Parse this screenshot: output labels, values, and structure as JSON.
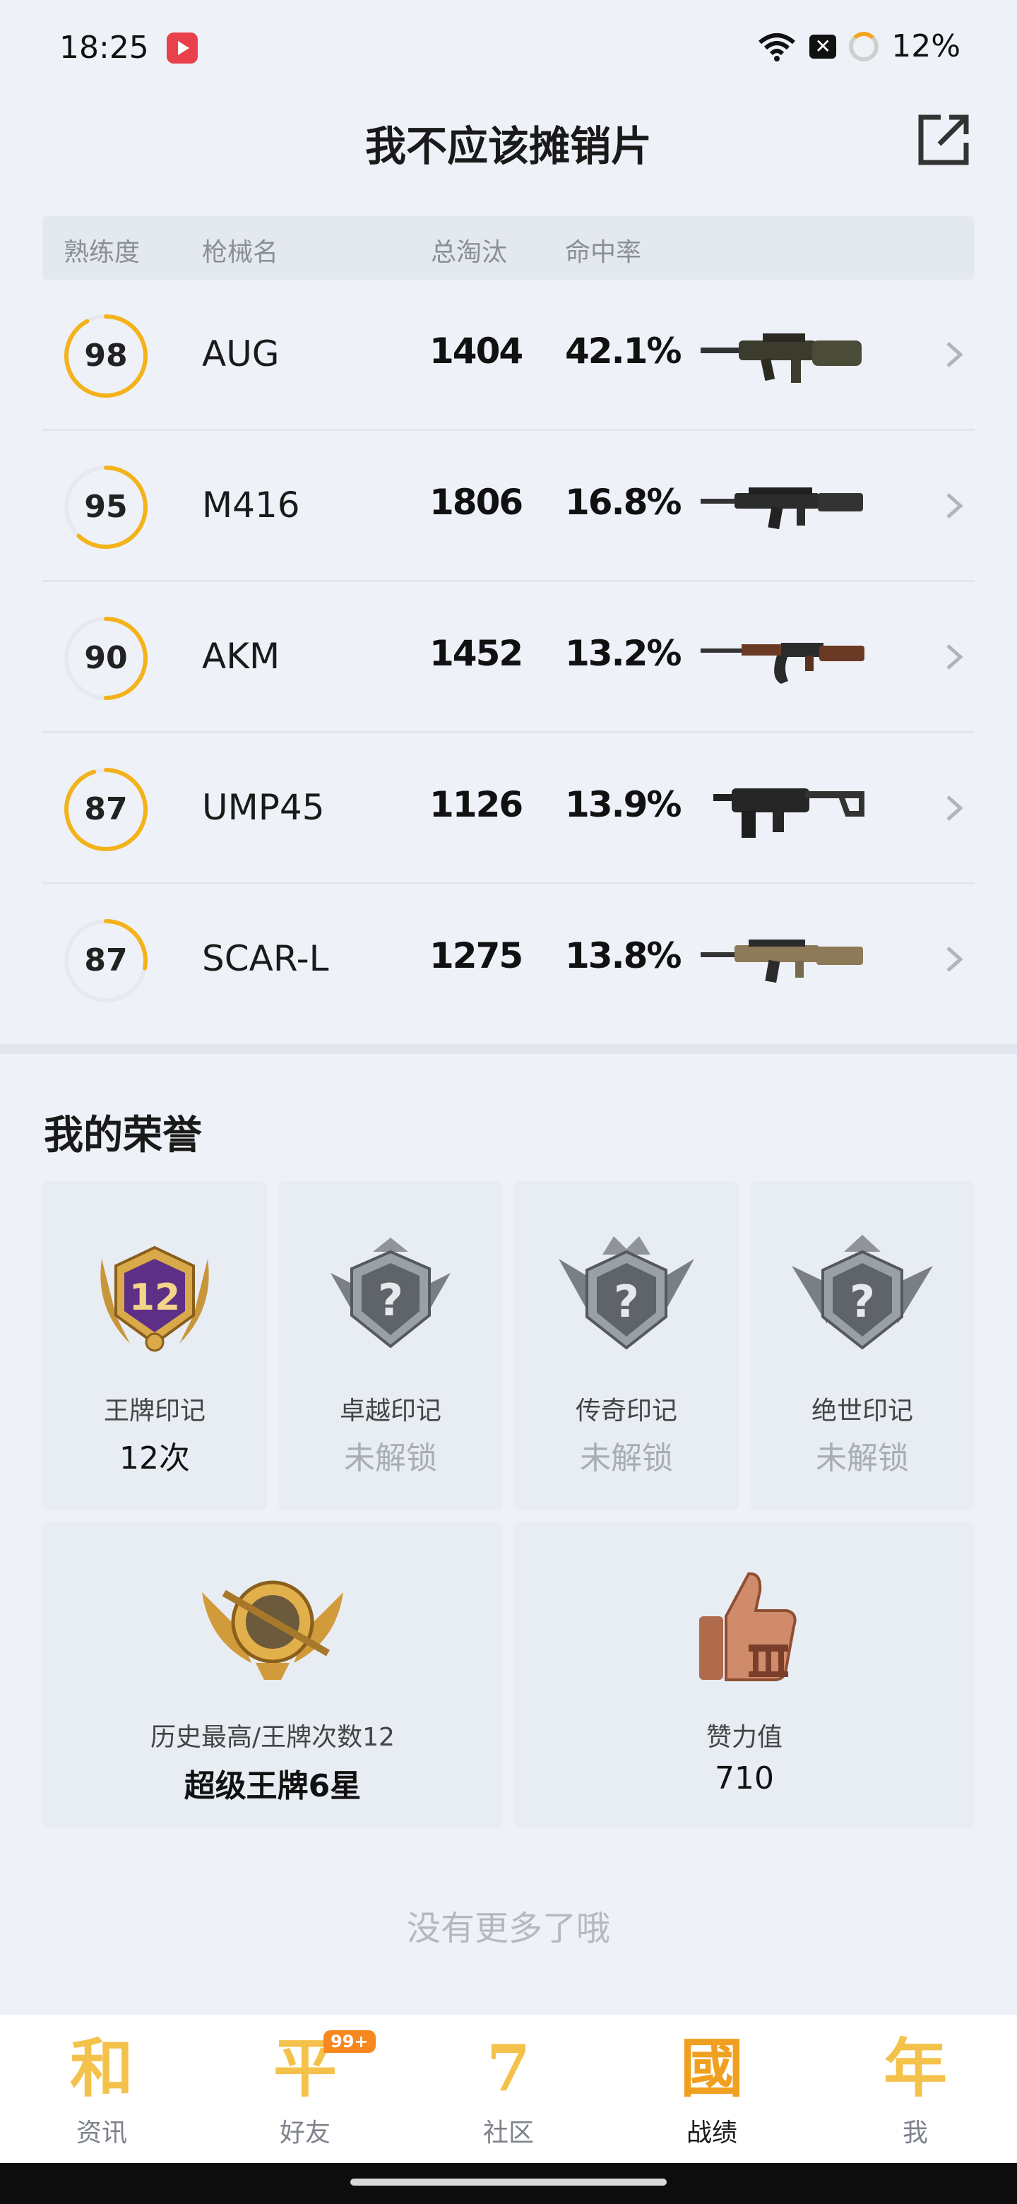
{
  "status_bar": {
    "time": "18:25",
    "battery": "12%"
  },
  "header": {
    "title": "我不应该摊销片"
  },
  "table": {
    "headers": [
      "熟练度",
      "枪械名",
      "总淘汰",
      "命中率"
    ],
    "rows": [
      {
        "mastery": "98",
        "name": "AUG",
        "kills": "1404",
        "accuracy": "42.1%",
        "gun_icon": "aug-rifle-icon",
        "progress": 0.92
      },
      {
        "mastery": "95",
        "name": "M416",
        "kills": "1806",
        "accuracy": "16.8%",
        "gun_icon": "m416-rifle-icon",
        "progress": 0.62
      },
      {
        "mastery": "90",
        "name": "AKM",
        "kills": "1452",
        "accuracy": "13.2%",
        "gun_icon": "akm-rifle-icon",
        "progress": 0.5
      },
      {
        "mastery": "87",
        "name": "UMP45",
        "kills": "1126",
        "accuracy": "13.9%",
        "gun_icon": "ump45-smg-icon",
        "progress": 0.95
      },
      {
        "mastery": "87",
        "name": "SCAR-L",
        "kills": "1275",
        "accuracy": "13.8%",
        "gun_icon": "scar-l-rifle-icon",
        "progress": 0.28
      }
    ]
  },
  "honors": {
    "title": "我的荣誉",
    "marks": [
      {
        "label": "王牌印记",
        "value": "12次",
        "locked": false,
        "emblem_text": "12",
        "icon": "ace-mark-icon"
      },
      {
        "label": "卓越印记",
        "value": "未解锁",
        "locked": true,
        "emblem_text": "?",
        "icon": "excellence-mark-icon"
      },
      {
        "label": "传奇印记",
        "value": "未解锁",
        "locked": true,
        "emblem_text": "?",
        "icon": "legend-mark-icon"
      },
      {
        "label": "绝世印记",
        "value": "未解锁",
        "locked": true,
        "emblem_text": "?",
        "icon": "peerless-mark-icon"
      }
    ],
    "tier": {
      "label": "历史最高/王牌次数12",
      "value": "超级王牌6星",
      "icon": "super-ace-tier-icon"
    },
    "likes": {
      "label": "赞力值",
      "value": "710",
      "icon": "thumbs-up-icon"
    }
  },
  "footer_note": "没有更多了哦",
  "nav": {
    "items": [
      {
        "glyph": "和",
        "label": "资讯",
        "active": false
      },
      {
        "glyph": "平",
        "label": "好友",
        "active": false,
        "badge": "99+"
      },
      {
        "glyph": "7",
        "label": "社区",
        "active": false
      },
      {
        "glyph": "國",
        "label": "战绩",
        "active": true
      },
      {
        "glyph": "年",
        "label": "我",
        "active": false
      }
    ]
  },
  "colors": {
    "accent": "#f4b21b",
    "track": "#e6e9ee",
    "background": "#eef2f8"
  }
}
